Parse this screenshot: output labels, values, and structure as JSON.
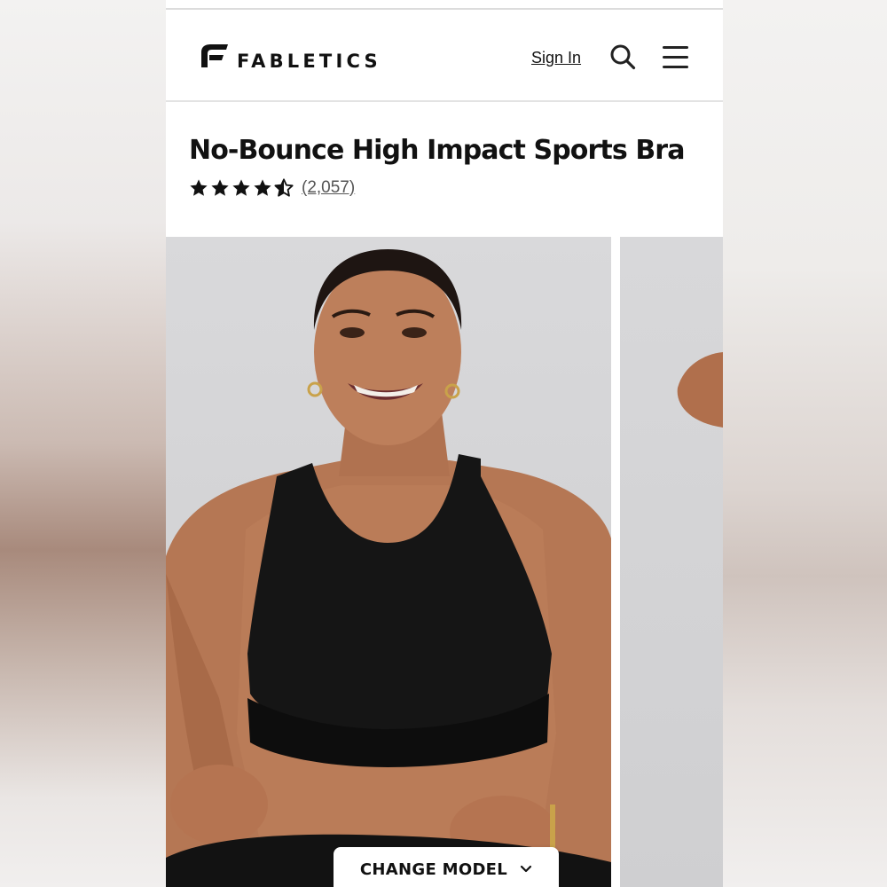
{
  "header": {
    "brand": "FABLETICS",
    "sign_in_label": "Sign In"
  },
  "product": {
    "title": "No-Bounce High Impact Sports Bra",
    "rating": 4.5,
    "rating_max": 5,
    "review_count_label": "(2,057)"
  },
  "gallery": {
    "change_model_label": "CHANGE MODEL"
  },
  "icons": {
    "logo": "fabletics-logo-icon",
    "search": "search-icon",
    "menu": "hamburger-menu-icon",
    "chevron": "chevron-down-icon",
    "star": "star-icon"
  },
  "colors": {
    "text": "#111111",
    "review_count": "#555555",
    "photo_background": "#d6d6d8",
    "garment": "#141414",
    "skin": "#b97b58"
  }
}
